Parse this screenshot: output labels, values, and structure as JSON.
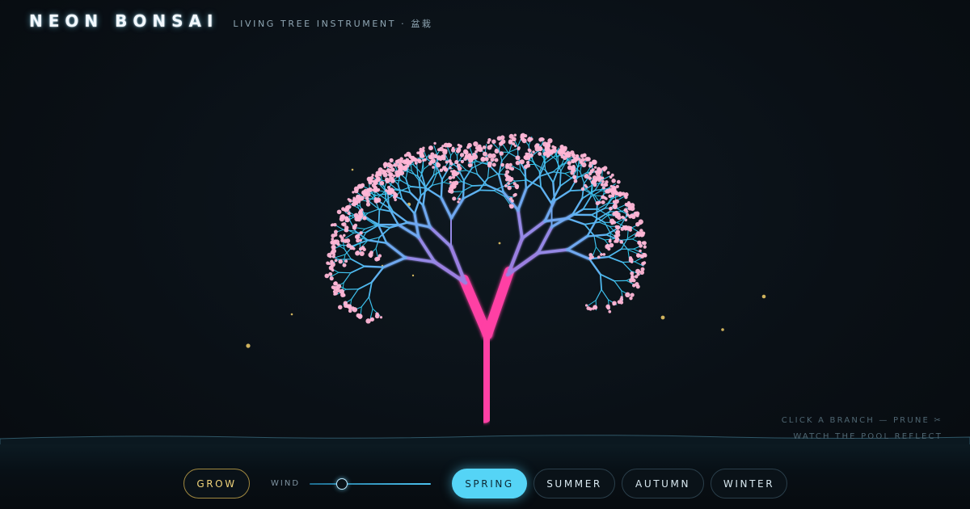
{
  "header": {
    "title": "NEON BONSAI",
    "subtitle": "LIVING TREE INSTRUMENT · 盆栽"
  },
  "hints": [
    "CLICK A BRANCH — PRUNE ✂",
    "WATCH THE POOL REFLECT"
  ],
  "controls": {
    "grow_label": "GROW",
    "wind_label": "WIND",
    "wind_value": 0.26,
    "seasons": [
      "SPRING",
      "SUMMER",
      "AUTUMN",
      "WINTER"
    ],
    "active_season": "SPRING"
  },
  "colors": {
    "trunk": "#ff3fa4",
    "branch_mid": "#9a7fe0",
    "branch_outer": "#2fc6ea",
    "blossom": "#ffb6d6",
    "firefly": "#f2cf6a",
    "accent": "#55d4f6"
  }
}
